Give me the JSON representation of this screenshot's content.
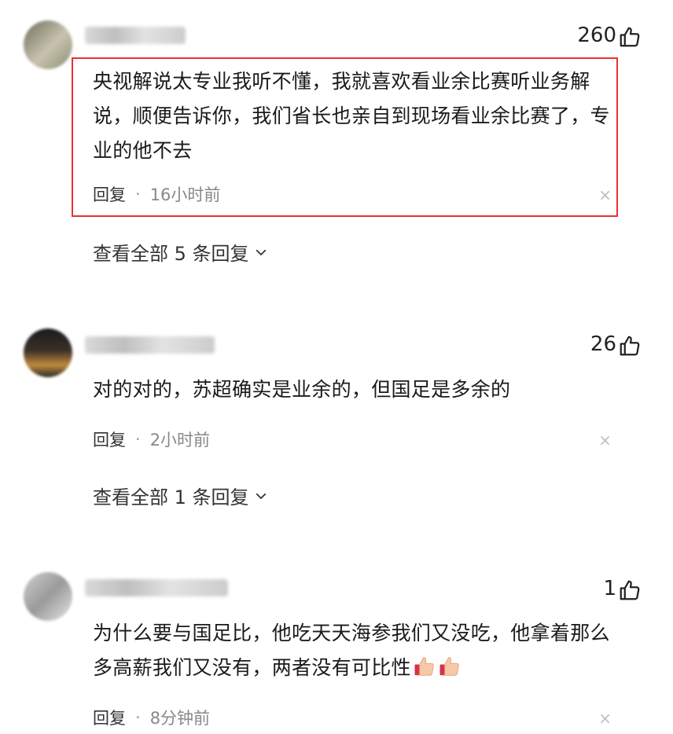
{
  "comments": [
    {
      "likes": "260",
      "text": "央视解说太专业我听不懂，我就喜欢看业余比赛听业务解说，顺便告诉你，我们省长也亲自到现场看业余比赛了，专业的他不去",
      "reply_label": "回复",
      "dot": "·",
      "time": "16小时前",
      "close": "×",
      "view_all": "查看全部 5 条回复"
    },
    {
      "likes": "26",
      "text": "对的对的，苏超确实是业余的，但国足是多余的",
      "reply_label": "回复",
      "dot": "·",
      "time": "2小时前",
      "close": "×",
      "view_all": "查看全部 1 条回复"
    },
    {
      "likes": "1",
      "text": "为什么要与国足比，他吃天天海参我们又没吃，他拿着那么多高薪我们又没有，两者没有可比性",
      "reply_label": "回复",
      "dot": "·",
      "time": "8分钟前",
      "close": "×"
    }
  ],
  "icons": {
    "thumb": "thumbs-up-icon",
    "chevron": "chevron-down-icon",
    "emoji": "thumbs-up-emoji"
  },
  "colors": {
    "highlight_border": "#e8322f"
  }
}
